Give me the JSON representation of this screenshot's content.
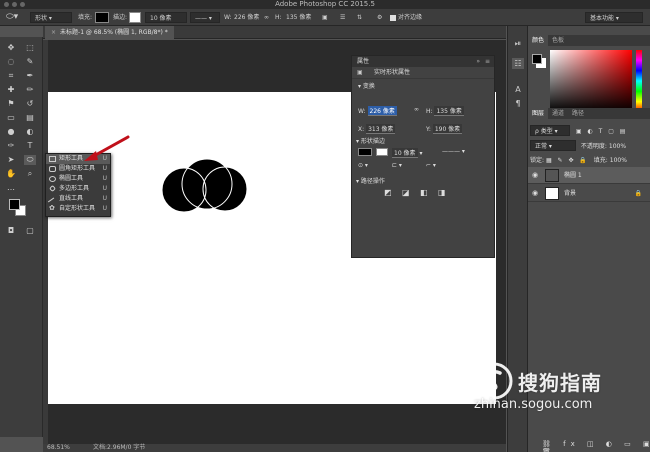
{
  "app": {
    "title": "Adobe Photoshop CC 2015.5"
  },
  "options_bar": {
    "shape_mode": "形状",
    "fill_label": "填充:",
    "stroke_label": "描边:",
    "stroke_width": "10 像素",
    "w_label": "W:",
    "w_value": "226 像素",
    "h_label": "H:",
    "h_value": "135 像素",
    "align_edges": "对齐边缘",
    "workspace": "基本功能"
  },
  "document_tab": {
    "label": "未标题-1 @ 68.5% (椭圆 1, RGB/8*) *"
  },
  "tool_flyout": {
    "items": [
      {
        "label": "矩形工具",
        "key": "U"
      },
      {
        "label": "圆角矩形工具",
        "key": "U"
      },
      {
        "label": "椭圆工具",
        "key": "U"
      },
      {
        "label": "多边形工具",
        "key": "U"
      },
      {
        "label": "直线工具",
        "key": "U"
      },
      {
        "label": "自定形状工具",
        "key": "U"
      }
    ]
  },
  "properties": {
    "panel_title": "属性",
    "subtitle": "实时形状属性",
    "transform_section": "变换",
    "w_label": "W:",
    "w_value": "226 像素",
    "h_label": "H:",
    "h_value": "135 像素",
    "x_label": "X:",
    "x_value": "313 像素",
    "y_label": "Y:",
    "y_value": "190 像素",
    "appearance_section": "形状描边",
    "stroke_width": "10 像素",
    "path_ops_section": "路径操作"
  },
  "right_panel": {
    "color_tabs": [
      "颜色",
      "色板"
    ],
    "layer_tabs": [
      "图层",
      "通道",
      "路径"
    ],
    "kind_filter": "类型",
    "blend_mode": "正常",
    "opacity_label": "不透明度:",
    "opacity_value": "100%",
    "lock_label": "锁定:",
    "fill_label": "填充:",
    "fill_value": "100%",
    "layers": [
      {
        "name": "椭圆 1"
      },
      {
        "name": "背景"
      }
    ]
  },
  "status": {
    "zoom": "68.51%",
    "doc_info": "文档:2.96M/0 字节"
  },
  "watermark": {
    "cn": "搜狗指南",
    "en": "zhinan.sogou.com"
  }
}
